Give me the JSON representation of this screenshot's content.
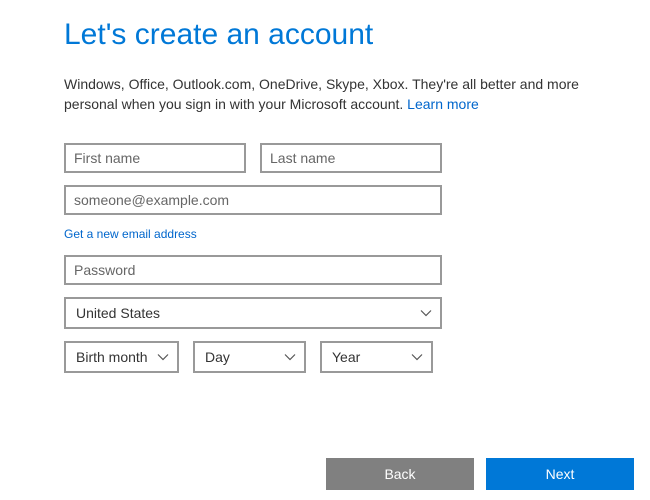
{
  "title": "Let's create an account",
  "description_part1": "Windows, Office, Outlook.com, OneDrive, Skype, Xbox. They're all better and more personal when you sign in with your Microsoft account. ",
  "learn_more": "Learn more",
  "fields": {
    "first_name_placeholder": "First name",
    "last_name_placeholder": "Last name",
    "email_placeholder": "someone@example.com",
    "password_placeholder": "Password"
  },
  "new_email_link": "Get a new email address",
  "country": {
    "selected": "United States"
  },
  "birth": {
    "month_label": "Birth month",
    "day_label": "Day",
    "year_label": "Year"
  },
  "buttons": {
    "back": "Back",
    "next": "Next"
  }
}
